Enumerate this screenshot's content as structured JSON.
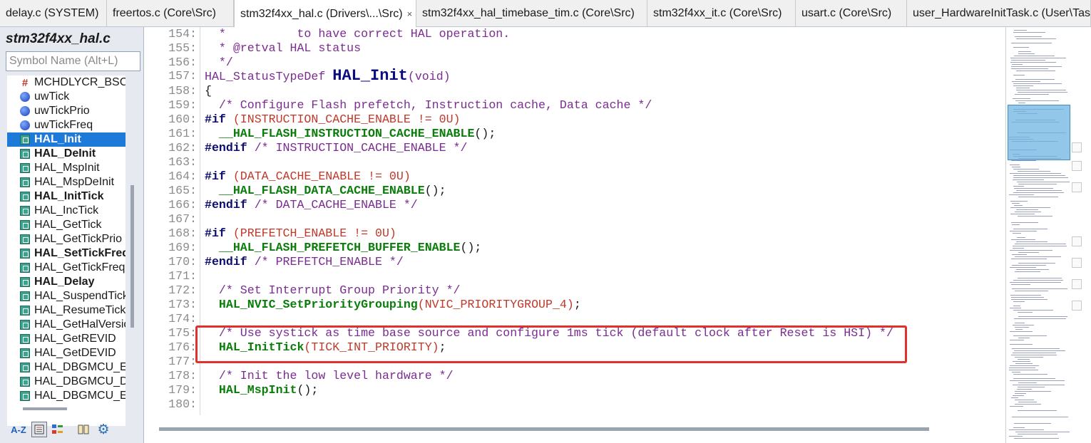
{
  "tabs": [
    {
      "label": "delay.c (SYSTEM)",
      "active": false
    },
    {
      "label": "freertos.c (Core\\Src)",
      "active": false
    },
    {
      "label": "stm32f4xx_hal.c (Drivers\\...\\Src)",
      "active": true,
      "close": "×"
    },
    {
      "label": "stm32f4xx_hal_timebase_tim.c (Core\\Src)",
      "active": false
    },
    {
      "label": "stm32f4xx_it.c (Core\\Src)",
      "active": false
    },
    {
      "label": "usart.c (Core\\Src)",
      "active": false
    },
    {
      "label": "user_HardwareInitTask.c (User\\Task",
      "active": false
    }
  ],
  "symbol_panel": {
    "title": "stm32f4xx_hal.c",
    "search_placeholder": "Symbol Name (Alt+L)",
    "items": [
      {
        "label": "MCHDLYCR_BSCKSEL",
        "icon": "macro-icon",
        "bold": false
      },
      {
        "label": "uwTick",
        "icon": "variable-icon",
        "bold": false
      },
      {
        "label": "uwTickPrio",
        "icon": "variable-icon",
        "bold": false
      },
      {
        "label": "uwTickFreq",
        "icon": "variable-icon",
        "bold": false
      },
      {
        "label": "HAL_Init",
        "icon": "function-icon",
        "bold": true,
        "selected": true
      },
      {
        "label": "HAL_DeInit",
        "icon": "function-icon",
        "bold": true
      },
      {
        "label": "HAL_MspInit",
        "icon": "function-icon",
        "bold": false
      },
      {
        "label": "HAL_MspDeInit",
        "icon": "function-icon",
        "bold": false
      },
      {
        "label": "HAL_InitTick",
        "icon": "function-icon",
        "bold": true
      },
      {
        "label": "HAL_IncTick",
        "icon": "function-icon",
        "bold": false
      },
      {
        "label": "HAL_GetTick",
        "icon": "function-icon",
        "bold": false
      },
      {
        "label": "HAL_GetTickPrio",
        "icon": "function-icon",
        "bold": false
      },
      {
        "label": "HAL_SetTickFreq",
        "icon": "function-icon",
        "bold": true
      },
      {
        "label": "HAL_GetTickFreq",
        "icon": "function-icon",
        "bold": false
      },
      {
        "label": "HAL_Delay",
        "icon": "function-icon",
        "bold": true
      },
      {
        "label": "HAL_SuspendTick",
        "icon": "function-icon",
        "bold": false
      },
      {
        "label": "HAL_ResumeTick",
        "icon": "function-icon",
        "bold": false
      },
      {
        "label": "HAL_GetHalVersion",
        "icon": "function-icon",
        "bold": false
      },
      {
        "label": "HAL_GetREVID",
        "icon": "function-icon",
        "bold": false
      },
      {
        "label": "HAL_GetDEVID",
        "icon": "function-icon",
        "bold": false
      },
      {
        "label": "HAL_DBGMCU_EnableDBGSleepMode",
        "icon": "function-icon",
        "bold": false
      },
      {
        "label": "HAL_DBGMCU_DisableDBGSleepMode",
        "icon": "function-icon",
        "bold": false
      },
      {
        "label": "HAL_DBGMCU_EnableDBGStopMode",
        "icon": "function-icon",
        "bold": false
      }
    ],
    "toolbar": {
      "sort_label": "A-Z"
    }
  },
  "code_lines": [
    {
      "n": "154:",
      "parts": [
        [
          "c-comment",
          "  *          to have correct HAL operation."
        ]
      ]
    },
    {
      "n": "155:",
      "parts": [
        [
          "c-comment",
          "  * @retval HAL status"
        ]
      ]
    },
    {
      "n": "156:",
      "parts": [
        [
          "c-comment",
          "  */"
        ]
      ]
    },
    {
      "n": "157:",
      "parts": [
        [
          "c-type",
          "HAL_StatusTypeDef "
        ],
        [
          "c-def",
          "HAL_Init"
        ],
        [
          "c-kw",
          "(void)"
        ]
      ]
    },
    {
      "n": "158:",
      "parts": [
        [
          "c-punc",
          "{"
        ]
      ]
    },
    {
      "n": "159:",
      "parts": [
        [
          "c-comment",
          "  /* Configure Flash prefetch, Instruction cache, Data cache */"
        ]
      ]
    },
    {
      "n": "160:",
      "parts": [
        [
          "c-pre",
          "#if "
        ],
        [
          "c-macro",
          "(INSTRUCTION_CACHE_ENABLE != 0U)"
        ]
      ]
    },
    {
      "n": "161:",
      "parts": [
        [
          "c-fn",
          "  __HAL_FLASH_INSTRUCTION_CACHE_ENABLE"
        ],
        [
          "c-punc",
          "();"
        ]
      ]
    },
    {
      "n": "162:",
      "parts": [
        [
          "c-pre",
          "#endif "
        ],
        [
          "c-comment",
          "/* INSTRUCTION_CACHE_ENABLE */"
        ]
      ]
    },
    {
      "n": "163:",
      "parts": []
    },
    {
      "n": "164:",
      "parts": [
        [
          "c-pre",
          "#if "
        ],
        [
          "c-macro",
          "(DATA_CACHE_ENABLE != 0U)"
        ]
      ]
    },
    {
      "n": "165:",
      "parts": [
        [
          "c-fn",
          "  __HAL_FLASH_DATA_CACHE_ENABLE"
        ],
        [
          "c-punc",
          "();"
        ]
      ]
    },
    {
      "n": "166:",
      "parts": [
        [
          "c-pre",
          "#endif "
        ],
        [
          "c-comment",
          "/* DATA_CACHE_ENABLE */"
        ]
      ]
    },
    {
      "n": "167:",
      "parts": []
    },
    {
      "n": "168:",
      "parts": [
        [
          "c-pre",
          "#if "
        ],
        [
          "c-macro",
          "(PREFETCH_ENABLE != 0U)"
        ]
      ]
    },
    {
      "n": "169:",
      "parts": [
        [
          "c-fn",
          "  __HAL_FLASH_PREFETCH_BUFFER_ENABLE"
        ],
        [
          "c-punc",
          "();"
        ]
      ]
    },
    {
      "n": "170:",
      "parts": [
        [
          "c-pre",
          "#endif "
        ],
        [
          "c-comment",
          "/* PREFETCH_ENABLE */"
        ]
      ]
    },
    {
      "n": "171:",
      "parts": []
    },
    {
      "n": "172:",
      "parts": [
        [
          "c-comment",
          "  /* Set Interrupt Group Priority */"
        ]
      ]
    },
    {
      "n": "173:",
      "parts": [
        [
          "c-fn",
          "  HAL_NVIC_SetPriorityGrouping"
        ],
        [
          "c-macro",
          "(NVIC_PRIORITYGROUP_4)"
        ],
        [
          "c-punc",
          ";"
        ]
      ]
    },
    {
      "n": "174:",
      "parts": []
    },
    {
      "n": "175:",
      "parts": [
        [
          "c-comment",
          "  /* Use systick as time base source and configure 1ms tick (default clock after Reset is HSI) */"
        ]
      ]
    },
    {
      "n": "176:",
      "parts": [
        [
          "c-fn",
          "  HAL_InitTick"
        ],
        [
          "c-macro",
          "(TICK_INT_PRIORITY)"
        ],
        [
          "c-punc",
          ";"
        ]
      ]
    },
    {
      "n": "177:",
      "parts": []
    },
    {
      "n": "178:",
      "parts": [
        [
          "c-comment",
          "  /* Init the low level hardware */"
        ]
      ]
    },
    {
      "n": "179:",
      "parts": [
        [
          "c-fn",
          "  HAL_MspInit"
        ],
        [
          "c-punc",
          "();"
        ]
      ]
    },
    {
      "n": "180:",
      "parts": []
    }
  ],
  "colors": {
    "highlight_border": "#e0312f",
    "selection": "#1e7ad8"
  }
}
